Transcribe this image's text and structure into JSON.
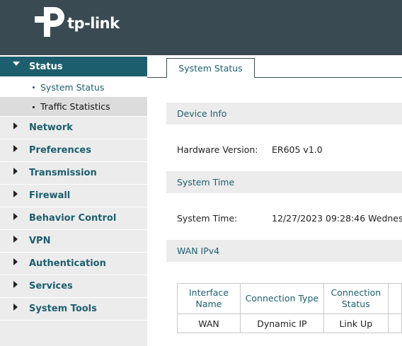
{
  "header": {
    "brand": "tp-link",
    "logo_icon": "tp-link-logo-icon",
    "background": "#3a4a52"
  },
  "sidebar": {
    "items": [
      {
        "label": "Status",
        "expanded": true,
        "children": [
          {
            "label": "System Status",
            "selected": true
          },
          {
            "label": "Traffic Statistics",
            "selected": false
          }
        ]
      },
      {
        "label": "Network"
      },
      {
        "label": "Preferences"
      },
      {
        "label": "Transmission"
      },
      {
        "label": "Firewall"
      },
      {
        "label": "Behavior Control"
      },
      {
        "label": "VPN"
      },
      {
        "label": "Authentication"
      },
      {
        "label": "Services"
      },
      {
        "label": "System Tools"
      }
    ],
    "accent": "#1d5e6e"
  },
  "main": {
    "tab": "System Status",
    "device_info": {
      "title": "Device Info",
      "hardware_label": "Hardware Version:",
      "hardware_value": "ER605 v1.0"
    },
    "system_time": {
      "title": "System Time",
      "label": "System Time:",
      "value": "12/27/2023 09:28:46 Wednes"
    },
    "wan": {
      "title": "WAN IPv4",
      "columns": [
        "Interface Name",
        "Connection Type",
        "Connection Status"
      ],
      "rows": [
        [
          "WAN",
          "Dynamic IP",
          "Link Up"
        ]
      ]
    }
  }
}
